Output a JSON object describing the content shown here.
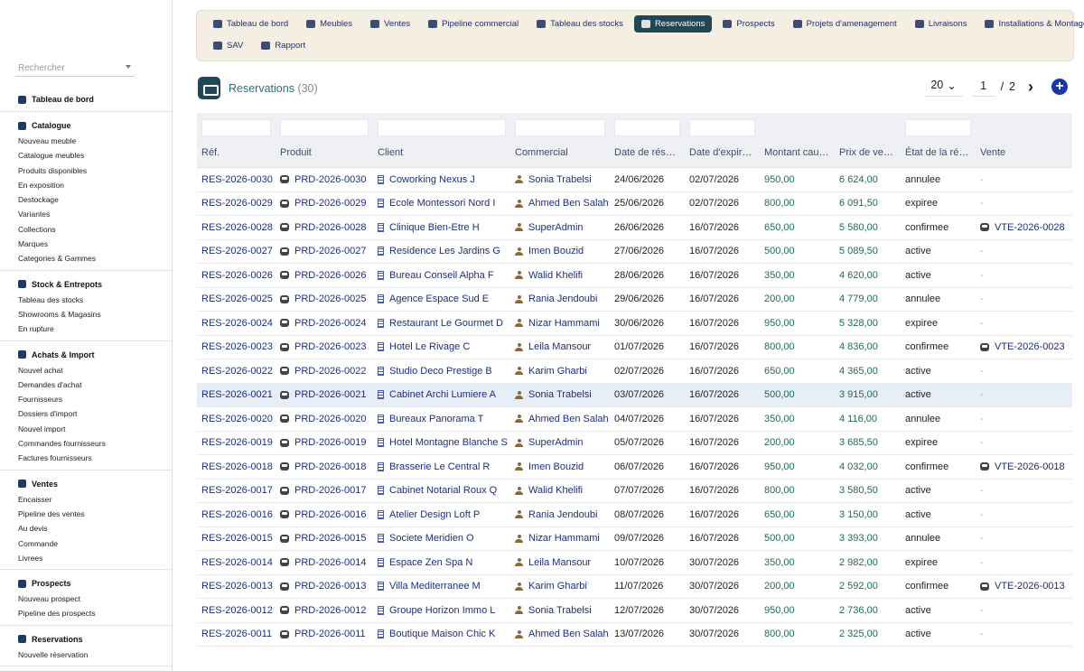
{
  "sidebar": {
    "search_placeholder": "Rechercher",
    "sections": [
      {
        "title": "Tableau de bord",
        "icon": "dashboard-icon",
        "items": []
      },
      {
        "title": "Catalogue",
        "icon": "grid-icon",
        "items": [
          "Nouveau meuble",
          "Catalogue meubles",
          "Produits disponibles",
          "En exposition",
          "Destockage",
          "Variantes",
          "Collections",
          "Marques",
          "Categories & Gammes"
        ]
      },
      {
        "title": "Stock & Entrepots",
        "icon": "warehouse-icon",
        "items": [
          "Tableau des stocks",
          "Showrooms & Magasins",
          "En rupture"
        ]
      },
      {
        "title": "Achats & Import",
        "icon": "import-icon",
        "items": [
          "Nouvel achat",
          "Demandes d'achat",
          "Fournisseurs",
          "Dossiers d'import",
          "Nouvel import",
          "Commandes fournisseurs",
          "Factures fournisseurs"
        ]
      },
      {
        "title": "Ventes",
        "icon": "handshake-icon",
        "items": [
          "Encaisser",
          "Pipeline des ventes",
          "Au devis",
          "Commande",
          "Livrees"
        ]
      },
      {
        "title": "Prospects",
        "icon": "user-plus-icon",
        "items": [
          "Nouveau prospect",
          "Pipeline des prospects"
        ]
      },
      {
        "title": "Reservations",
        "icon": "bookmark-icon",
        "items": [
          "Nouvelle réservation"
        ]
      }
    ]
  },
  "topnav": {
    "row1": [
      {
        "label": "Tableau de bord",
        "icon": "dashboard-icon"
      },
      {
        "label": "Meubles",
        "icon": "grid-icon"
      },
      {
        "label": "Ventes",
        "icon": "handshake-icon"
      },
      {
        "label": "Pipeline commercial",
        "icon": "list-icon"
      },
      {
        "label": "Tableau des stocks",
        "icon": "table-icon"
      },
      {
        "label": "Reservations",
        "icon": "bookmark-icon",
        "active": true
      },
      {
        "label": "Prospects",
        "icon": "user-plus-icon"
      },
      {
        "label": "Projets d'amenagement",
        "icon": "project-icon"
      },
      {
        "label": "Livraisons",
        "icon": "truck-icon"
      },
      {
        "label": "Installations & Montage",
        "icon": "tools-icon"
      }
    ],
    "row2": [
      {
        "label": "SAV",
        "icon": "wrench-icon"
      },
      {
        "label": "Rapport",
        "icon": "pie-chart-icon"
      }
    ],
    "active_color": "#1f4755"
  },
  "header": {
    "title": "Reservations",
    "count": "(30)",
    "per_page": "20",
    "page": "1",
    "separator": "/",
    "total_pages": "2",
    "next_icon": "chevron-right-icon",
    "add_icon": "plus-circle-icon"
  },
  "table": {
    "columns": [
      "Réf.",
      "Produit",
      "Client",
      "Commercial",
      "Date de rése…",
      "Date d'expir…",
      "Montant caut…",
      "Prix de vente",
      "État de la ré…",
      "Vente"
    ],
    "rows": [
      [
        "RES-2026-0030",
        "PRD-2026-0030",
        "Coworking Nexus J",
        "Sonia Trabelsi",
        "24/06/2026",
        "02/07/2026",
        "950,00",
        "6 624,00",
        "annulee",
        "-"
      ],
      [
        "RES-2026-0029",
        "PRD-2026-0029",
        "Ecole Montessori Nord I",
        "Ahmed Ben Salah",
        "25/06/2026",
        "02/07/2026",
        "800,00",
        "6 091,50",
        "expiree",
        "-"
      ],
      [
        "RES-2026-0028",
        "PRD-2026-0028",
        "Clinique Bien-Etre H",
        "SuperAdmin",
        "26/06/2026",
        "16/07/2026",
        "650,00",
        "5 580,00",
        "confirmee",
        "VTE-2026-0028"
      ],
      [
        "RES-2026-0027",
        "PRD-2026-0027",
        "Residence Les Jardins G",
        "Imen Bouzid",
        "27/06/2026",
        "16/07/2026",
        "500,00",
        "5 089,50",
        "active",
        "-"
      ],
      [
        "RES-2026-0026",
        "PRD-2026-0026",
        "Bureau Conseil Alpha F",
        "Walid Khelifi",
        "28/06/2026",
        "16/07/2026",
        "350,00",
        "4 620,00",
        "active",
        "-"
      ],
      [
        "RES-2026-0025",
        "PRD-2026-0025",
        "Agence Espace Sud E",
        "Rania Jendoubi",
        "29/06/2026",
        "16/07/2026",
        "200,00",
        "4 779,00",
        "annulee",
        "-"
      ],
      [
        "RES-2026-0024",
        "PRD-2026-0024",
        "Restaurant Le Gourmet D",
        "Nizar Hammami",
        "30/06/2026",
        "16/07/2026",
        "950,00",
        "5 328,00",
        "expiree",
        "-"
      ],
      [
        "RES-2026-0023",
        "PRD-2026-0023",
        "Hotel Le Rivage C",
        "Leila Mansour",
        "01/07/2026",
        "16/07/2026",
        "800,00",
        "4 836,00",
        "confirmee",
        "VTE-2026-0023"
      ],
      [
        "RES-2026-0022",
        "PRD-2026-0022",
        "Studio Deco Prestige B",
        "Karim Gharbi",
        "02/07/2026",
        "16/07/2026",
        "650,00",
        "4 365,00",
        "active",
        "-"
      ],
      [
        "RES-2026-0021",
        "PRD-2026-0021",
        "Cabinet Archi Lumiere A",
        "Sonia Trabelsi",
        "03/07/2026",
        "16/07/2026",
        "500,00",
        "3 915,00",
        "active",
        "-"
      ],
      [
        "RES-2026-0020",
        "PRD-2026-0020",
        "Bureaux Panorama T",
        "Ahmed Ben Salah",
        "04/07/2026",
        "16/07/2026",
        "350,00",
        "4 116,00",
        "annulee",
        "-"
      ],
      [
        "RES-2026-0019",
        "PRD-2026-0019",
        "Hotel Montagne Blanche S",
        "SuperAdmin",
        "05/07/2026",
        "16/07/2026",
        "200,00",
        "3 685,50",
        "expiree",
        "-"
      ],
      [
        "RES-2026-0018",
        "PRD-2026-0018",
        "Brasserie Le Central R",
        "Imen Bouzid",
        "06/07/2026",
        "16/07/2026",
        "950,00",
        "4 032,00",
        "confirmee",
        "VTE-2026-0018"
      ],
      [
        "RES-2026-0017",
        "PRD-2026-0017",
        "Cabinet Notarial Roux Q",
        "Walid Khelifi",
        "07/07/2026",
        "16/07/2026",
        "800,00",
        "3 580,50",
        "active",
        "-"
      ],
      [
        "RES-2026-0016",
        "PRD-2026-0016",
        "Atelier Design Loft P",
        "Rania Jendoubi",
        "08/07/2026",
        "16/07/2026",
        "650,00",
        "3 150,00",
        "active",
        "-"
      ],
      [
        "RES-2026-0015",
        "PRD-2026-0015",
        "Societe Meridien O",
        "Nizar Hammami",
        "09/07/2026",
        "16/07/2026",
        "500,00",
        "3 393,00",
        "annulee",
        "-"
      ],
      [
        "RES-2026-0014",
        "PRD-2026-0014",
        "Espace Zen Spa N",
        "Leila Mansour",
        "10/07/2026",
        "30/07/2026",
        "350,00",
        "2 982,00",
        "expiree",
        "-"
      ],
      [
        "RES-2026-0013",
        "PRD-2026-0013",
        "Villa Mediterranee M",
        "Karim Gharbi",
        "11/07/2026",
        "30/07/2026",
        "200,00",
        "2 592,00",
        "confirmee",
        "VTE-2026-0013"
      ],
      [
        "RES-2026-0012",
        "PRD-2026-0012",
        "Groupe Horizon Immo L",
        "Sonia Trabelsi",
        "12/07/2026",
        "30/07/2026",
        "950,00",
        "2 736,00",
        "active",
        "-"
      ],
      [
        "RES-2026-0011",
        "PRD-2026-0011",
        "Boutique Maison Chic K",
        "Ahmed Ben Salah",
        "13/07/2026",
        "30/07/2026",
        "800,00",
        "2 325,00",
        "active",
        "-"
      ]
    ],
    "highlighted_row": 9,
    "colors": {
      "link": "#1d2f7a",
      "amount": "#1d6b57",
      "header_bg": "#eef0f4",
      "highlight": "#e8eef7"
    }
  }
}
